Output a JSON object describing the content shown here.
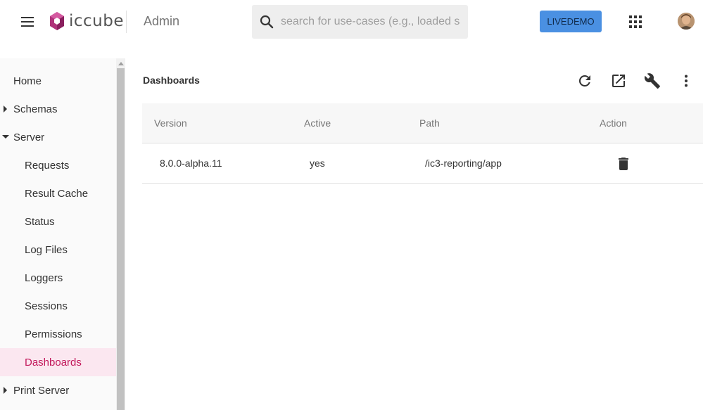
{
  "header": {
    "logo_text": "iccube",
    "app_title": "Admin",
    "search_placeholder": "search for use-cases (e.g., loaded s",
    "livedemo_label": "LIVEDEMO",
    "brand_color": "#4a90e2"
  },
  "sidebar": {
    "items": [
      {
        "label": "Home",
        "level": "top",
        "caret": "none"
      },
      {
        "label": "Schemas",
        "level": "top",
        "caret": "right"
      },
      {
        "label": "Server",
        "level": "top",
        "caret": "down"
      },
      {
        "label": "Requests",
        "level": "sub"
      },
      {
        "label": "Result Cache",
        "level": "sub"
      },
      {
        "label": "Status",
        "level": "sub"
      },
      {
        "label": "Log Files",
        "level": "sub"
      },
      {
        "label": "Loggers",
        "level": "sub"
      },
      {
        "label": "Sessions",
        "level": "sub"
      },
      {
        "label": "Permissions",
        "level": "sub"
      },
      {
        "label": "Dashboards",
        "level": "sub",
        "active": true
      },
      {
        "label": "Print Server",
        "level": "top",
        "caret": "right"
      }
    ],
    "active_color": "#c2185b"
  },
  "main": {
    "title": "Dashboards",
    "tools": [
      "refresh-icon",
      "open-in-new-icon",
      "wrench-icon",
      "more-vert-icon"
    ],
    "table": {
      "columns": [
        "Version",
        "Active",
        "Path",
        "Action"
      ],
      "rows": [
        {
          "version": "8.0.0-alpha.11",
          "active": "yes",
          "path": "/ic3-reporting/app",
          "action": "delete-icon"
        }
      ]
    }
  }
}
